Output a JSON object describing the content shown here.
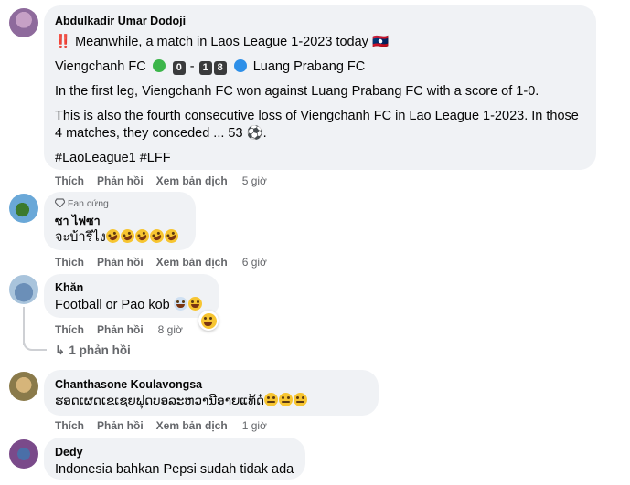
{
  "comments": [
    {
      "author": "Abdulkadir Umar Dodoji",
      "line1": "‼️ Meanwhile, a match in Laos League 1-2023 today 🇱🇦",
      "score_home": "Viengchanh FC",
      "score_left": "0",
      "score_dash": "-",
      "score_right_a": "1",
      "score_right_b": "8",
      "score_away": "Luang Prabang FC",
      "para2": "In the first leg, Viengchanh FC won against Luang Prabang FC with a score of 1-0.",
      "para3a": "This is also the fourth consecutive loss of Viengchanh FC in Lao League 1-2023. In those",
      "para3b": "4 matches, they conceded ... 53 ⚽.",
      "hashtags": "#LaoLeague1 #LFF",
      "like": "Thích",
      "reply": "Phản hồi",
      "translate": "Xem bản dịch",
      "time": "5 giờ"
    },
    {
      "badge": "Fan cứng",
      "author": "ซา ไฟซา",
      "text": "จะบ้ารึไง",
      "like": "Thích",
      "reply": "Phản hồi",
      "translate": "Xem bản dịch",
      "time": "6 giờ"
    },
    {
      "author": "Khăn",
      "text": "Football or Pao kob",
      "like": "Thích",
      "reply": "Phản hồi",
      "time": "8 giờ",
      "replies": "1 phản hồi"
    },
    {
      "author": "Chanthasone Koulavongsa",
      "text": "ຮອດເຜດເຂເຊຍຟຸດບອລະຫວານີອາຍແທ້ດ໋",
      "like": "Thích",
      "reply": "Phản hồi",
      "translate": "Xem bản dịch",
      "time": "1 giờ"
    },
    {
      "author": "Dedy",
      "text": "Indonesia bahkan Pepsi sudah tidak ada"
    }
  ],
  "colors": {
    "bubble": "#f0f2f5",
    "meta": "#65676b",
    "score_chip": "#3a3b3c",
    "green_dot": "#3cb54a",
    "blue_dot": "#2d8fe8"
  }
}
